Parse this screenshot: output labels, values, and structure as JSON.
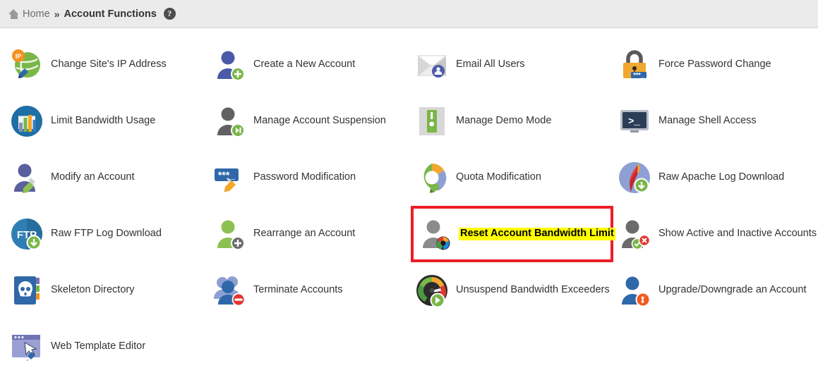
{
  "breadcrumb": {
    "home_label": "Home",
    "separator": "»",
    "current_label": "Account Functions",
    "help_glyph": "?",
    "home_icon": "home-icon",
    "help_icon": "help-circle-icon"
  },
  "colors": {
    "header_bg": "#ebebeb",
    "header_border": "#d4d4d4",
    "text": "#333333",
    "highlight_border": "#ee1c25",
    "highlight_text_bg": "#ffff00",
    "blue": "#3a5fa8",
    "green": "#7ab648",
    "orange": "#f5911e",
    "gray": "#6b6b6b",
    "teal": "#1d6fa5"
  },
  "items": [
    {
      "label": "Change Site's IP Address",
      "icon": "globe-ip-pencil-icon"
    },
    {
      "label": "Create a New Account",
      "icon": "user-plus-icon"
    },
    {
      "label": "Email All Users",
      "icon": "envelope-users-icon"
    },
    {
      "label": "Force Password Change",
      "icon": "padlock-password-icon"
    },
    {
      "label": "Limit Bandwidth Usage",
      "icon": "bar-chart-circle-icon"
    },
    {
      "label": "Manage Account Suspension",
      "icon": "user-pause-icon"
    },
    {
      "label": "Manage Demo Mode",
      "icon": "toggle-switch-icon"
    },
    {
      "label": "Manage Shell Access",
      "icon": "terminal-monitor-icon"
    },
    {
      "label": "Modify an Account",
      "icon": "user-pencil-icon"
    },
    {
      "label": "Password Modification",
      "icon": "password-field-pencil-icon"
    },
    {
      "label": "Quota Modification",
      "icon": "donut-chart-pencil-icon"
    },
    {
      "label": "Raw Apache Log Download",
      "icon": "apache-feather-download-icon"
    },
    {
      "label": "Raw FTP Log Download",
      "icon": "ftp-download-icon"
    },
    {
      "label": "Rearrange an Account",
      "icon": "user-move-icon"
    },
    {
      "label": "Reset Account Bandwidth Limit",
      "icon": "user-reset-icon",
      "highlighted": true
    },
    {
      "label": "Show Active and Inactive Accounts",
      "icon": "user-active-inactive-icon"
    },
    {
      "label": "Skeleton Directory",
      "icon": "skull-directory-icon"
    },
    {
      "label": "Terminate Accounts",
      "icon": "users-terminate-icon"
    },
    {
      "label": "Unsuspend Bandwidth Exceeders",
      "icon": "gauge-play-icon"
    },
    {
      "label": "Upgrade/Downgrade an Account",
      "icon": "user-upgrade-icon"
    },
    {
      "label": "Web Template Editor",
      "icon": "browser-window-pencil-icon"
    }
  ]
}
